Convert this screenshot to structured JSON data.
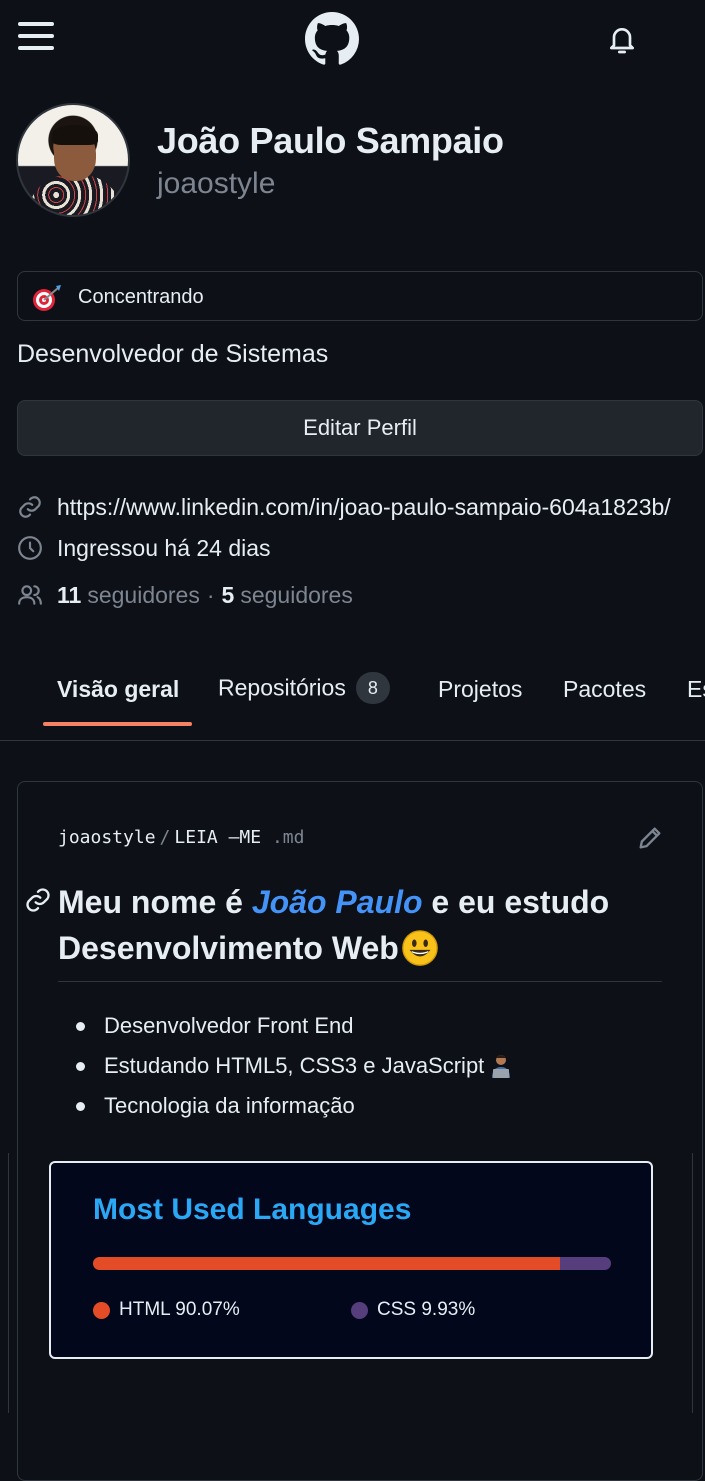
{
  "profile": {
    "full_name": "João Paulo Sampaio",
    "username": "joaostyle",
    "status_text": "Concentrando",
    "status_icon": "direct-hit-emoji",
    "bio": "Desenvolvedor de Sistemas",
    "edit_button_label": "Editar Perfil",
    "website": "https://www.linkedin.com/in/joao-paulo-sampaio-604a1823b/",
    "joined": "Ingressou há 24 dias",
    "followers_count": "11",
    "followers_label": "seguidores",
    "separator": "·",
    "following_count": "5",
    "following_label": "seguidores"
  },
  "tabs": [
    {
      "label": "Visão geral",
      "active": true
    },
    {
      "label": "Repositórios",
      "counter": "8"
    },
    {
      "label": "Projetos"
    },
    {
      "label": "Pacotes"
    },
    {
      "label": "Es"
    }
  ],
  "readme": {
    "owner": "joaostyle",
    "path_sep": "/",
    "filename": "LEIA —ME",
    "extension": ".md",
    "heading_before": "Meu nome é ",
    "heading_highlight": "João Paulo",
    "heading_after": " eu estudo Desenvolvimento Web",
    "heading_after_e": " e",
    "items": [
      "Desenvolvedor Front End",
      "Estudando HTML5, CSS3 e JavaScript",
      "Tecnologia da informação"
    ]
  },
  "languages": {
    "title": "Most Used Languages",
    "entries": [
      {
        "name": "HTML",
        "percent": 90.07,
        "label": "HTML 90.07%",
        "color": "#e34c26"
      },
      {
        "name": "CSS",
        "percent": 9.93,
        "label": "CSS 9.93%",
        "color": "#563d7c"
      }
    ]
  },
  "colors": {
    "background": "#0d1117",
    "border": "#30363d",
    "muted": "#7d8590",
    "link": "#4493f8",
    "tab_accent": "#f78166",
    "lang_title": "#2aa8f5"
  }
}
